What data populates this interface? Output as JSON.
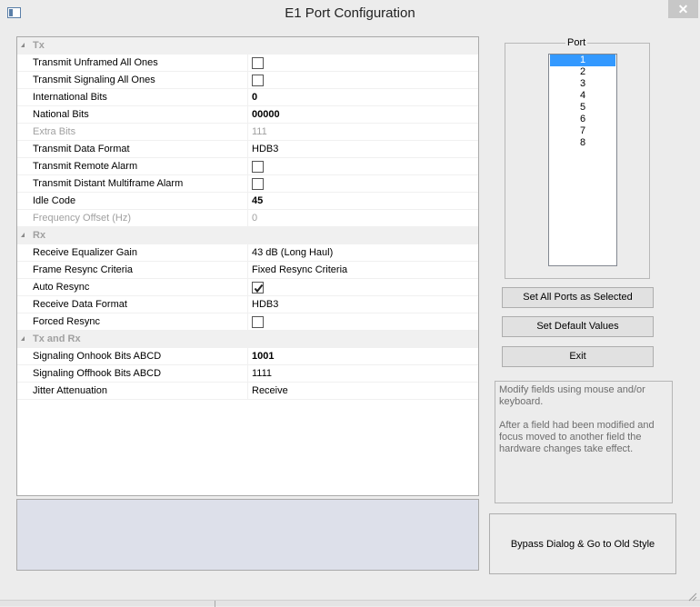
{
  "window": {
    "title": "E1 Port Configuration",
    "close_glyph": "✕"
  },
  "grid": {
    "rows": [
      {
        "kind": "category",
        "label": "Tx"
      },
      {
        "kind": "check",
        "label": "Transmit Unframed All Ones",
        "checked": false
      },
      {
        "kind": "check",
        "label": "Transmit Signaling All Ones",
        "checked": false
      },
      {
        "kind": "text",
        "label": "International Bits",
        "value": "0",
        "bold": true
      },
      {
        "kind": "text",
        "label": "National Bits",
        "value": "00000",
        "bold": true
      },
      {
        "kind": "text",
        "label": "Extra Bits",
        "value": "111",
        "disabled": true
      },
      {
        "kind": "text",
        "label": "Transmit Data Format",
        "value": "HDB3"
      },
      {
        "kind": "check",
        "label": "Transmit Remote Alarm",
        "checked": false
      },
      {
        "kind": "check",
        "label": "Transmit Distant Multiframe Alarm",
        "checked": false
      },
      {
        "kind": "text",
        "label": "Idle Code",
        "value": "45",
        "bold": true
      },
      {
        "kind": "text",
        "label": "Frequency Offset (Hz)",
        "value": "0",
        "disabled": true
      },
      {
        "kind": "category",
        "label": "Rx"
      },
      {
        "kind": "text",
        "label": "Receive Equalizer Gain",
        "value": "43 dB (Long Haul)"
      },
      {
        "kind": "text",
        "label": "Frame Resync Criteria",
        "value": "Fixed Resync Criteria"
      },
      {
        "kind": "check",
        "label": "Auto Resync",
        "checked": true
      },
      {
        "kind": "text",
        "label": "Receive Data Format",
        "value": "HDB3"
      },
      {
        "kind": "check",
        "label": "Forced Resync",
        "checked": false
      },
      {
        "kind": "category",
        "label": "Tx and Rx"
      },
      {
        "kind": "text",
        "label": "Signaling Onhook Bits ABCD",
        "value": "1001",
        "bold": true
      },
      {
        "kind": "text",
        "label": "Signaling Offhook Bits ABCD",
        "value": "1111"
      },
      {
        "kind": "text",
        "label": "Jitter Attenuation",
        "value": "Receive"
      }
    ]
  },
  "port": {
    "legend": "Port",
    "items": [
      "1",
      "2",
      "3",
      "4",
      "5",
      "6",
      "7",
      "8"
    ],
    "selected": "1"
  },
  "buttons": {
    "set_all_ports": "Set All Ports as Selected",
    "set_defaults": "Set Default Values",
    "exit": "Exit",
    "bypass": "Bypass  Dialog & Go to Old Style"
  },
  "info": {
    "line1": "Modify fields using mouse and/or keyboard.",
    "line2": "After a field had been modified and focus moved to another field the hardware changes take effect."
  },
  "colors": {
    "selection": "#3399ff",
    "window_bg": "#ececec",
    "description_bg": "#dde0ea"
  }
}
